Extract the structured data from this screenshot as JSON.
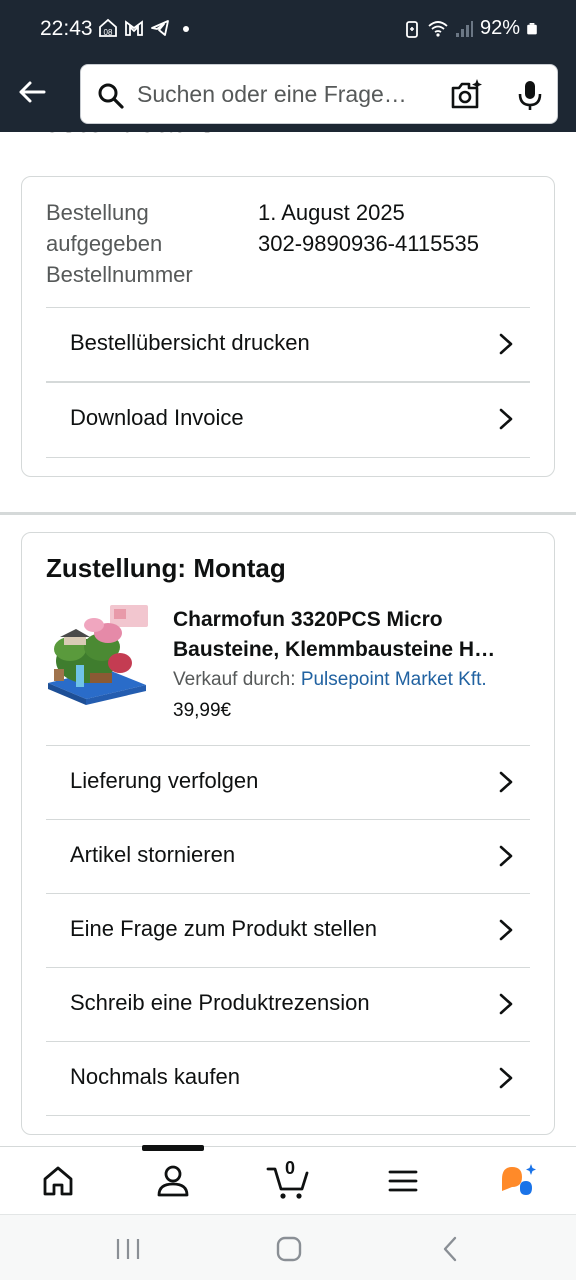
{
  "status_bar": {
    "time": "22:43",
    "battery": "92%",
    "left_icons": [
      "home-notification-icon",
      "gmail-icon",
      "telegram-icon",
      "dot-icon"
    ],
    "right_icons": [
      "battery-saver-icon",
      "wifi-icon",
      "signal-icon",
      "battery-icon"
    ]
  },
  "header": {
    "search_placeholder": "Suchen oder eine Frage…",
    "back_icon": "arrow-left-icon",
    "camera_icon": "camera-sparkle-icon",
    "mic_icon": "microphone-icon"
  },
  "page": {
    "title": "Bestelldetails"
  },
  "order": {
    "labels": [
      "Bestellung",
      "aufgegeben",
      "Bestellnummer"
    ],
    "date": "1. August 2025",
    "number": "302-9890936-4115535",
    "actions": [
      {
        "label": "Bestellübersicht drucken"
      },
      {
        "label": "Download Invoice"
      }
    ]
  },
  "delivery": {
    "title": "Zustellung: Montag",
    "product": {
      "title": "Charmofun 3320PCS Micro Bausteine, Klemmbausteine H…",
      "seller_prefix": "Verkauf durch:",
      "seller_name": "Pulsepoint Market Kft.",
      "price": "39,99€"
    },
    "actions": [
      {
        "label": "Lieferung verfolgen"
      },
      {
        "label": "Artikel stornieren"
      },
      {
        "label": "Eine Frage zum Produkt stellen"
      },
      {
        "label": "Schreib eine Produktrezension"
      },
      {
        "label": "Nochmals kaufen"
      }
    ]
  },
  "bottom_nav": {
    "items": [
      "home-icon",
      "account-icon",
      "cart-icon",
      "menu-icon",
      "rufus-assistant-icon"
    ],
    "cart_count": "0"
  },
  "colors": {
    "header_bg": "#1d2733",
    "link": "#2162a1",
    "text": "#0f1111",
    "muted": "#565959",
    "border": "#d5d9d9",
    "assistant_orange": "#ff8a29",
    "assistant_blue": "#1a73e8"
  }
}
